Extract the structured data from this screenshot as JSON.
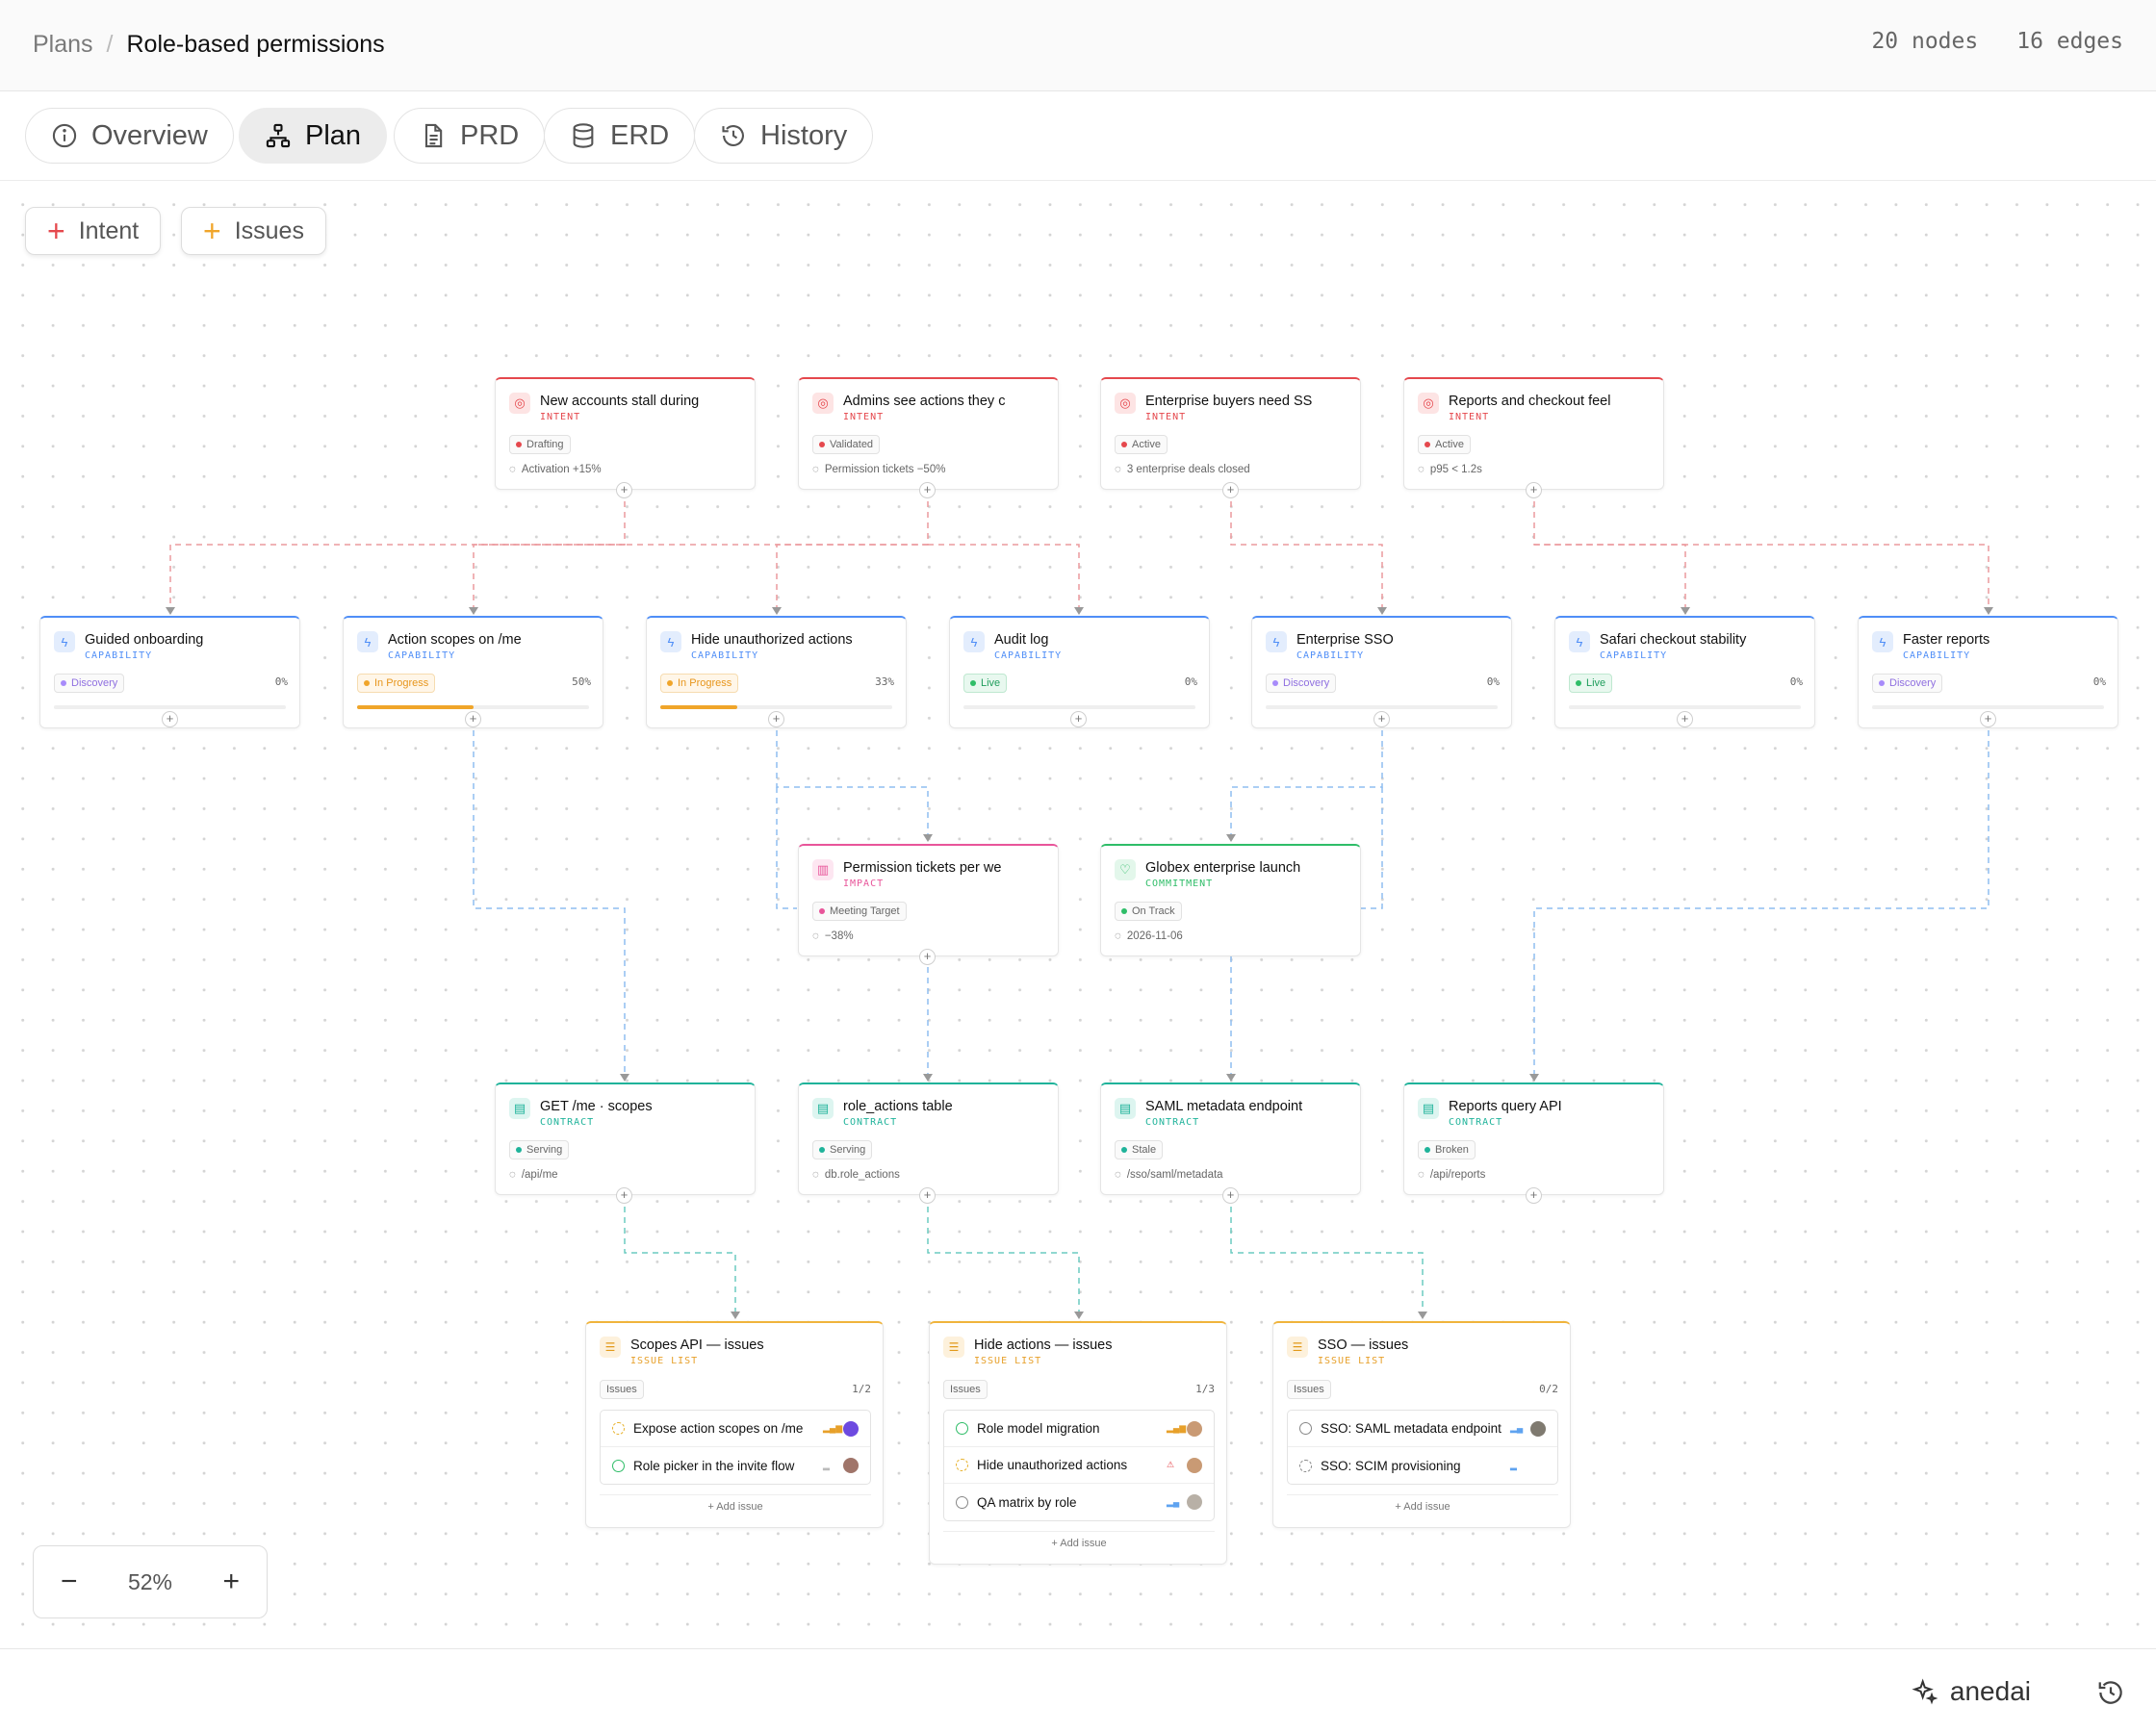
{
  "breadcrumb": {
    "parent": "Plans",
    "separator": "/",
    "current": "Role-based permissions"
  },
  "counts": {
    "nodes": "20 nodes",
    "edges": "16 edges"
  },
  "tabs": [
    {
      "label": "Overview",
      "icon": "info-icon"
    },
    {
      "label": "Plan",
      "icon": "sitemap-icon",
      "active": true
    },
    {
      "label": "PRD",
      "icon": "document-icon"
    },
    {
      "label": "ERD",
      "icon": "database-icon"
    },
    {
      "label": "History",
      "icon": "history-icon"
    }
  ],
  "toolbar": {
    "intent_label": "Intent",
    "issues_label": "Issues"
  },
  "colors": {
    "intent": "#e5484d",
    "capability": "#4f8ef7",
    "impact": "#e8559a",
    "commitment": "#2fbd68",
    "contract": "#1fb39a",
    "issue_list": "#f0b43c"
  },
  "intents": [
    {
      "title": "New accounts stall during",
      "kind": "INTENT",
      "status": "Drafting",
      "metric": "Activation +15%"
    },
    {
      "title": "Admins see actions they c",
      "kind": "INTENT",
      "status": "Validated",
      "metric": "Permission tickets −50%"
    },
    {
      "title": "Enterprise buyers need SS",
      "kind": "INTENT",
      "status": "Active",
      "metric": "3 enterprise deals closed"
    },
    {
      "title": "Reports and checkout feel",
      "kind": "INTENT",
      "status": "Active",
      "metric": "p95 < 1.2s"
    }
  ],
  "capabilities": [
    {
      "title": "Guided onboarding",
      "kind": "CAPABILITY",
      "status": "Discovery",
      "progress": 0,
      "pct": "0%"
    },
    {
      "title": "Action scopes on /me",
      "kind": "CAPABILITY",
      "status": "In Progress",
      "progress": 50,
      "pct": "50%"
    },
    {
      "title": "Hide unauthorized actions",
      "kind": "CAPABILITY",
      "status": "In Progress",
      "progress": 33,
      "pct": "33%"
    },
    {
      "title": "Audit log",
      "kind": "CAPABILITY",
      "status": "Live",
      "progress": 0,
      "pct": "0%"
    },
    {
      "title": "Enterprise SSO",
      "kind": "CAPABILITY",
      "status": "Discovery",
      "progress": 0,
      "pct": "0%"
    },
    {
      "title": "Safari checkout stability",
      "kind": "CAPABILITY",
      "status": "Live",
      "progress": 0,
      "pct": "0%"
    },
    {
      "title": "Faster reports",
      "kind": "CAPABILITY",
      "status": "Discovery",
      "progress": 0,
      "pct": "0%"
    }
  ],
  "impact": {
    "title": "Permission tickets per we",
    "kind": "IMPACT",
    "status": "Meeting Target",
    "metric": "−38%"
  },
  "commitment": {
    "title": "Globex enterprise launch",
    "kind": "COMMITMENT",
    "status": "On Track",
    "metric": "2026-11-06"
  },
  "contracts": [
    {
      "title": "GET /me · scopes",
      "kind": "CONTRACT",
      "status": "Serving",
      "metric": "/api/me"
    },
    {
      "title": "role_actions table",
      "kind": "CONTRACT",
      "status": "Serving",
      "metric": "db.role_actions"
    },
    {
      "title": "SAML metadata endpoint",
      "kind": "CONTRACT",
      "status": "Stale",
      "metric": "/sso/saml/metadata"
    },
    {
      "title": "Reports query API",
      "kind": "CONTRACT",
      "status": "Broken",
      "metric": "/api/reports"
    }
  ],
  "issue_lists": [
    {
      "title": "Scopes API — issues",
      "kind": "ISSUE LIST",
      "tag": "Issues",
      "count": "1/2",
      "add": "+ Add issue",
      "items": [
        "Expose action scopes on /me",
        "Role picker in the invite flow"
      ]
    },
    {
      "title": "Hide actions — issues",
      "kind": "ISSUE LIST",
      "tag": "Issues",
      "count": "1/3",
      "add": "+ Add issue",
      "items": [
        "Role model migration",
        "Hide unauthorized actions",
        "QA matrix by role"
      ]
    },
    {
      "title": "SSO — issues",
      "kind": "ISSUE LIST",
      "tag": "Issues",
      "count": "0/2",
      "add": "+ Add issue",
      "items": [
        "SSO: SAML metadata endpoint",
        "SSO: SCIM provisioning"
      ]
    }
  ],
  "zoom": {
    "minus": "−",
    "level": "52%",
    "plus": "+"
  },
  "footer": {
    "brand": "anedai"
  }
}
